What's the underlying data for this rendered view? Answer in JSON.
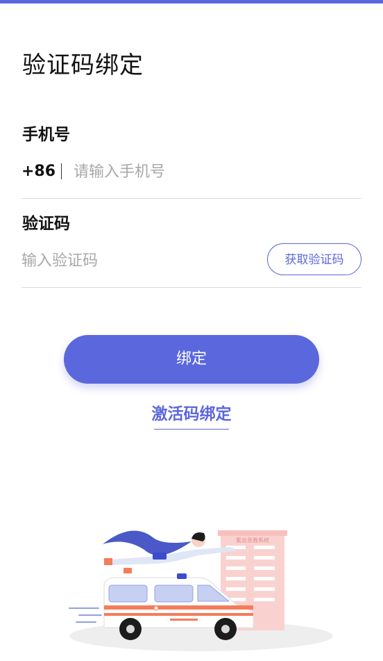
{
  "page": {
    "title": "验证码绑定"
  },
  "phone": {
    "label": "手机号",
    "prefix": "+86",
    "placeholder": "请输入手机号",
    "value": ""
  },
  "code": {
    "label": "验证码",
    "placeholder": "输入验证码",
    "value": "",
    "get_code_label": "获取验证码"
  },
  "actions": {
    "bind_label": "绑定",
    "alt_link_label": "激活码绑定"
  },
  "illustration": {
    "building_sign": "紫云急救系统",
    "subject": "superhero-flying-over-ambulance"
  },
  "colors": {
    "accent": "#5b67dc",
    "ambulance_stripe": "#f47c5a",
    "building": "#f7c9c8"
  }
}
